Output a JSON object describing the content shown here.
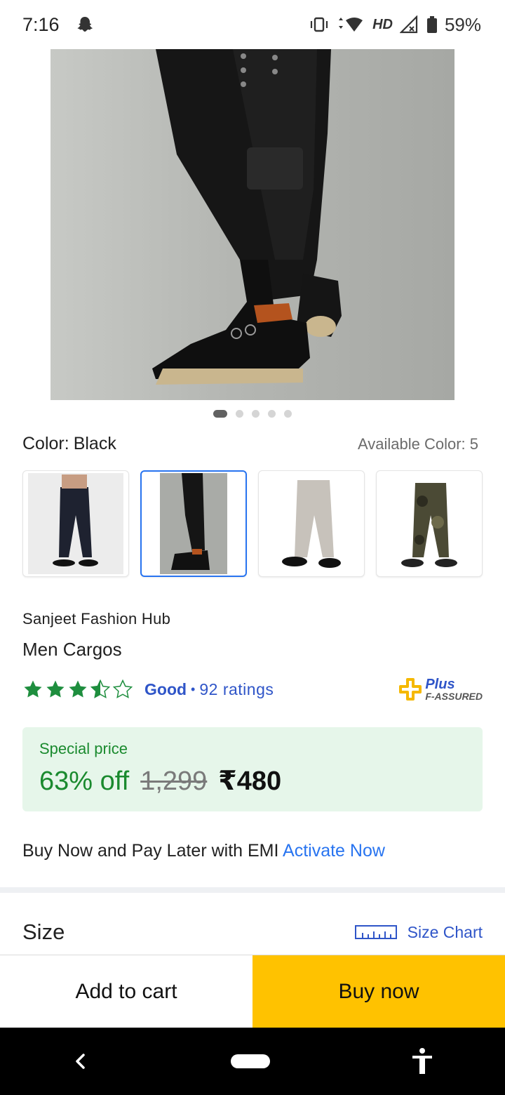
{
  "status_bar": {
    "time": "7:16",
    "network": "HD",
    "battery": "59%"
  },
  "gallery": {
    "dot_count": 5,
    "active_index": 0
  },
  "color": {
    "label": "Color:",
    "value": "Black",
    "available": "Available Color: 5",
    "swatches": [
      "black-cargo",
      "black-cargo-side",
      "grey-cargo",
      "camo-cargo"
    ],
    "selected_index": 1
  },
  "product": {
    "seller": "Sanjeet Fashion Hub",
    "name": "Men Cargos"
  },
  "rating": {
    "stars": 3.5,
    "label": "Good",
    "separator": "•",
    "count": "92 ratings",
    "assured_plus": "Plus",
    "assured_text": "F-ASSURED"
  },
  "price": {
    "special_label": "Special price",
    "discount": "63% off",
    "mrp": "1,299",
    "final": "₹480"
  },
  "emi": {
    "text": "Buy Now and Pay Later with EMI ",
    "link": "Activate Now"
  },
  "size": {
    "title": "Size",
    "chart_label": "Size Chart"
  },
  "actions": {
    "add_to_cart": "Add to cart",
    "buy_now": "Buy now"
  },
  "colors": {
    "accent": "#2874f0",
    "buy_button": "#ffc200",
    "green": "#1a8a2e",
    "price_box_bg": "#e6f6ea"
  }
}
